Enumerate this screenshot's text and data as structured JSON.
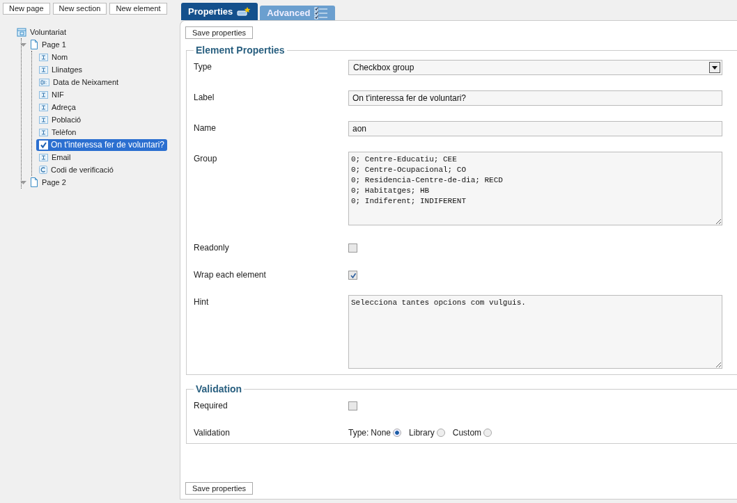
{
  "toolbar": [
    "New page",
    "New section",
    "New element"
  ],
  "tree": [
    {
      "label": "Voluntariat",
      "kind": "form",
      "selected": false,
      "children": [
        {
          "label": "Page 1",
          "kind": "page",
          "selected": false,
          "children": [
            {
              "label": "Nom",
              "kind": "text",
              "selected": false
            },
            {
              "label": "Llinatges",
              "kind": "text",
              "selected": false
            },
            {
              "label": "Data de Neixament",
              "kind": "date",
              "selected": false
            },
            {
              "label": "NIF",
              "kind": "text",
              "selected": false
            },
            {
              "label": "Adreça",
              "kind": "text",
              "selected": false
            },
            {
              "label": "Població",
              "kind": "text",
              "selected": false
            },
            {
              "label": "Telèfon",
              "kind": "text",
              "selected": false
            },
            {
              "label": "On t'interessa fer de voluntari?",
              "kind": "checkbox",
              "selected": true
            },
            {
              "label": "Email",
              "kind": "text",
              "selected": false
            },
            {
              "label": "Codi de verificació",
              "kind": "captcha",
              "selected": false
            }
          ]
        },
        {
          "label": "Page 2",
          "kind": "page",
          "selected": false
        }
      ]
    }
  ],
  "tabs": [
    {
      "label": "Properties",
      "kind": "properties",
      "selected": true
    },
    {
      "label": "Advanced",
      "kind": "advanced",
      "selected": false
    }
  ],
  "save_button_top": "Save properties",
  "sections": [
    {
      "title": "Element Properties",
      "fields": [
        {
          "label": "Type",
          "kind": "select",
          "value": "Checkbox group"
        },
        {
          "label": "Label",
          "kind": "text",
          "value": "On t'interessa fer de voluntari?"
        },
        {
          "label": "Name",
          "kind": "text",
          "value": "aon"
        },
        {
          "label": "Group",
          "kind": "textarea",
          "value": "0; Centre-Educatiu; CEE\n0; Centre-Ocupacional; CO\n0; Residencia-Centre-de-dia; RECD\n0; Habitatges; HB\n0; Indiferent; INDIFERENT"
        },
        {
          "label": "Readonly",
          "kind": "checkbox",
          "checked": false
        },
        {
          "label": "Wrap each element",
          "kind": "checkbox",
          "checked": true
        },
        {
          "label": "Hint",
          "kind": "textarea",
          "value": "Selecciona tantes opcions com vulguis."
        }
      ]
    },
    {
      "title": "Validation",
      "fields": [
        {
          "label": "Required",
          "kind": "checkbox",
          "checked": false
        },
        {
          "label": "Validation",
          "kind": "radio",
          "prefix": "Type:",
          "options": [
            {
              "label": "None",
              "selected": true
            },
            {
              "label": "Library",
              "selected": false
            },
            {
              "label": "Custom",
              "selected": false
            }
          ]
        }
      ]
    }
  ],
  "save_button_bottom": "Save properties"
}
